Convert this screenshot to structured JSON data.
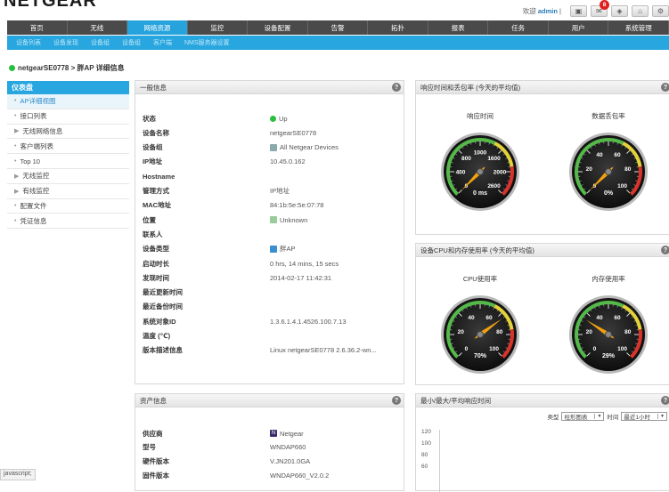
{
  "brand": {
    "logo": "NETGEAR"
  },
  "topbar": {
    "welcome": "欢迎",
    "user": "admin",
    "separator": "|",
    "mail_badge": "8"
  },
  "main_nav": [
    "首页",
    "无线",
    "网络资源",
    "监控",
    "设备配置",
    "告警",
    "拓扑",
    "报表",
    "任务",
    "用户",
    "系统管理"
  ],
  "main_nav_active": 2,
  "sub_nav": [
    "设备列表",
    "设备发现",
    "设备组",
    "设备组",
    "客户端",
    "NMS服务器设置"
  ],
  "breadcrumb": "netgearSE0778 > 胖AP 详细信息",
  "sidebar": {
    "title": "仪表盘",
    "items": [
      {
        "marker": "•",
        "label": "AP详细视图",
        "active": true
      },
      {
        "marker": "•",
        "label": "接口列表"
      },
      {
        "marker": "▶",
        "label": "无线网络信息"
      },
      {
        "marker": "•",
        "label": "客户端列表"
      },
      {
        "marker": "•",
        "label": "Top 10"
      },
      {
        "marker": "▶",
        "label": "无线监控"
      },
      {
        "marker": "▶",
        "label": "有线监控"
      },
      {
        "marker": "•",
        "label": "配置文件"
      },
      {
        "marker": "•",
        "label": "凭证信息"
      }
    ]
  },
  "general_info": {
    "title": "一般信息",
    "rows": [
      {
        "k": "状态",
        "v": "Up"
      },
      {
        "k": "设备名称",
        "v": "netgearSE0778"
      },
      {
        "k": "设备组",
        "v": "All Netgear Devices"
      },
      {
        "k": "IP地址",
        "v": "10.45.0.162"
      },
      {
        "k": "Hostname",
        "v": ""
      },
      {
        "k": "管理方式",
        "v": "IP地址"
      },
      {
        "k": "MAC地址",
        "v": "84:1b:5e:5e:07:78"
      },
      {
        "k": "位置",
        "v": "Unknown"
      },
      {
        "k": "联系人",
        "v": ""
      },
      {
        "k": "设备类型",
        "v": "胖AP"
      },
      {
        "k": "启动时长",
        "v": "0 hrs, 14 mins, 15 secs"
      },
      {
        "k": "发现时间",
        "v": "2014-02-17 11:42:31"
      },
      {
        "k": "最近更新时间",
        "v": ""
      },
      {
        "k": "最近备份时间",
        "v": ""
      },
      {
        "k": "系统对象ID",
        "v": "1.3.6.1.4.1.4526.100.7.13"
      },
      {
        "k": "温度 (℃)",
        "v": ""
      },
      {
        "k": "版本描述信息",
        "v": "Linux netgearSE0778 2.6.36.2-wn..."
      }
    ]
  },
  "asset_info": {
    "title": "资产信息",
    "rows": [
      {
        "k": "供应商",
        "v": "Netgear"
      },
      {
        "k": "型号",
        "v": "WNDAP660"
      },
      {
        "k": "硬件版本",
        "v": "V.JN201.0GA"
      },
      {
        "k": "固件版本",
        "v": "WNDAP660_V2.0.2"
      }
    ]
  },
  "response_panel": {
    "title": "响应时间和丢包率 (今天的平均值)",
    "gauge1": {
      "label": "响应时间",
      "ticks": [
        "0",
        "400",
        "800",
        "1000",
        "1600",
        "2000",
        "2600"
      ],
      "value_text": "0 ms",
      "value": 0
    },
    "gauge2": {
      "label": "数据丢包率",
      "ticks": [
        "0",
        "20",
        "40",
        "60",
        "80",
        "100"
      ],
      "value_text": "0%",
      "value": 0
    }
  },
  "cpu_panel": {
    "title": "设备CPU和内存使用率 (今天的平均值)",
    "gauge1": {
      "label": "CPU使用率",
      "ticks": [
        "0",
        "20",
        "40",
        "60",
        "80",
        "100"
      ],
      "value_text": "70%",
      "value": 70
    },
    "gauge2": {
      "label": "内存使用率",
      "ticks": [
        "0",
        "20",
        "40",
        "60",
        "80",
        "100"
      ],
      "value_text": "29%",
      "value": 29
    }
  },
  "minmax_panel": {
    "title": "最小/最大/平均响应时间",
    "type_label": "类型",
    "type_value": "柱形图表",
    "time_label": "时间",
    "time_value": "最近1小时",
    "yticks": [
      "120",
      "100",
      "80",
      "60"
    ]
  },
  "status_bar": "javascript;",
  "help": "?",
  "colors": {
    "accent": "#27a6df",
    "nav": "#4a4a4a",
    "status_up": "#2bbf40",
    "needle": "#f0a010"
  }
}
